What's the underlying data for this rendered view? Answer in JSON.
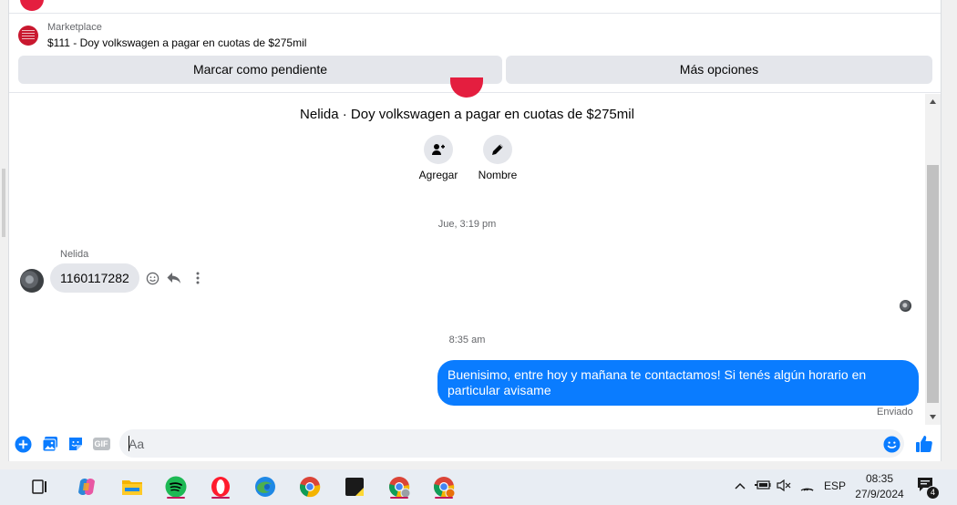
{
  "marketplace": {
    "label": "Marketplace",
    "title": "$111 - Doy volkswagen a pagar en cuotas de $275mil"
  },
  "header_buttons": {
    "pending_label": "Marcar como pendiente",
    "more_label": "Más opciones"
  },
  "conversation": {
    "title": "Nelida · Doy volkswagen a pagar en cuotas de $275mil",
    "actions": [
      {
        "label": "Agregar",
        "icon": "add-person-icon"
      },
      {
        "label": "Nombre",
        "icon": "pencil-icon"
      }
    ]
  },
  "messages": {
    "timestamp_1": "Jue, 3:19 pm",
    "sender_name": "Nelida",
    "incoming_text": "1160117282",
    "timestamp_2": "8:35 am",
    "outgoing_text": "Buenisimo, entre hoy y mañana te contactamos! Si tenés algún horario en particular avisame",
    "outgoing_status": "Enviado"
  },
  "composer": {
    "placeholder": "Aa",
    "gif_label": "GIF"
  },
  "taskbar": {
    "language": "ESP",
    "time": "08:35",
    "date": "27/9/2024",
    "notification_count": "4"
  },
  "colors": {
    "accent": "#0a7cff",
    "bubble_incoming": "#e4e6eb",
    "brand_red": "#e41e3f"
  }
}
